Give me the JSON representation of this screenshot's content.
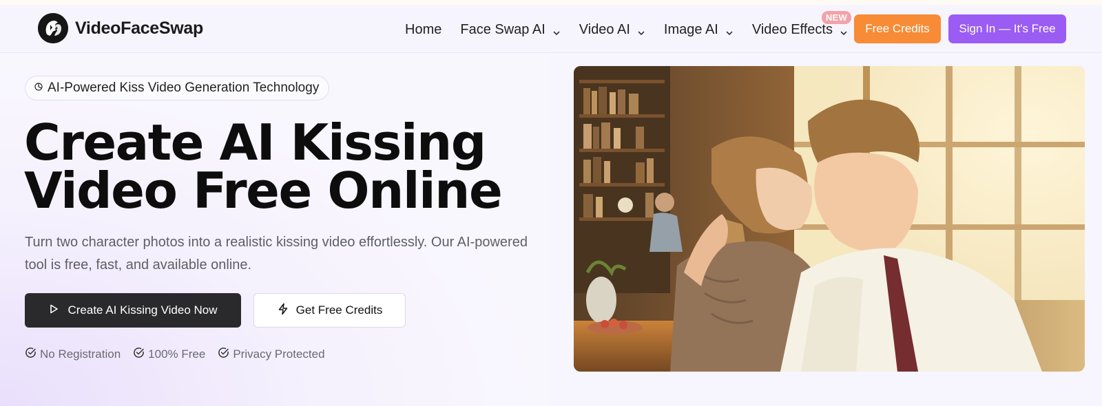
{
  "brand": {
    "name": "VideoFaceSwap",
    "logo_icon": "face-profile-logo"
  },
  "nav": {
    "items": [
      {
        "label": "Home",
        "dropdown": false
      },
      {
        "label": "Face Swap AI",
        "dropdown": true
      },
      {
        "label": "Video AI",
        "dropdown": true
      },
      {
        "label": "Image AI",
        "dropdown": true
      },
      {
        "label": "Video Effects",
        "dropdown": true,
        "badge": "NEW"
      }
    ],
    "free_credits_label": "Free Credits",
    "sign_in_label": "Sign In — It's Free"
  },
  "hero": {
    "tag": "AI-Powered Kiss Video Generation Technology",
    "headline_line1": "Create AI Kissing",
    "headline_line2": "Video Free Online",
    "description": "Turn two character photos into a realistic kissing video effortlessly. Our AI-powered tool is free, fast, and available online.",
    "primary_button": "Create AI Kissing Video Now",
    "secondary_button": "Get Free Credits",
    "features": [
      "No Registration",
      "100% Free",
      "Privacy Protected"
    ]
  },
  "colors": {
    "accent_orange": "#f78b36",
    "accent_purple": "#9a5cf3",
    "primary_dark": "#2a2a2d",
    "badge_pink": "#f2a2a8"
  },
  "icons": {
    "tag": "sparkle-icon",
    "primary_button": "play-icon",
    "secondary_button": "lightning-icon",
    "feature": "check-circle-icon",
    "dropdown": "chevron-down-icon"
  }
}
